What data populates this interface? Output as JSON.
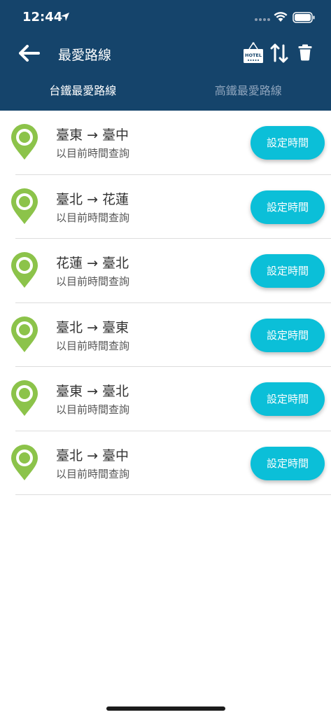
{
  "status": {
    "time": "12:44"
  },
  "nav": {
    "title": "最愛路線",
    "hotel_label": "HOTEL"
  },
  "tabs": [
    {
      "label": "台鐵最愛路線",
      "active": true
    },
    {
      "label": "高鐵最愛路線",
      "active": false
    }
  ],
  "routes": [
    {
      "from": "臺東",
      "arrow": "→",
      "to": "臺中",
      "sub": "以目前時間查詢",
      "button": "設定時間"
    },
    {
      "from": "臺北",
      "arrow": "→",
      "to": "花蓮",
      "sub": "以目前時間查詢",
      "button": "設定時間"
    },
    {
      "from": "花蓮",
      "arrow": "→",
      "to": "臺北",
      "sub": "以目前時間查詢",
      "button": "設定時間"
    },
    {
      "from": "臺北",
      "arrow": "→",
      "to": "臺東",
      "sub": "以目前時間查詢",
      "button": "設定時間"
    },
    {
      "from": "臺東",
      "arrow": "→",
      "to": "臺北",
      "sub": "以目前時間查詢",
      "button": "設定時間"
    },
    {
      "from": "臺北",
      "arrow": "→",
      "to": "臺中",
      "sub": "以目前時間查詢",
      "button": "設定時間"
    }
  ],
  "colors": {
    "header": "#15446b",
    "accent": "#0bbfd8",
    "pin": "#8cc34a"
  },
  "icons": {
    "back": "arrow-left-icon",
    "hotel": "hotel-sign-icon",
    "swap": "swap-vertical-icon",
    "delete": "trash-icon",
    "pin": "map-pin-icon"
  }
}
